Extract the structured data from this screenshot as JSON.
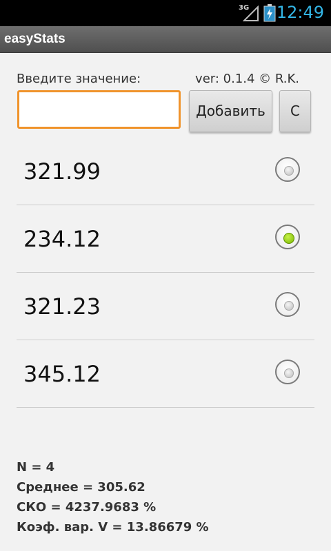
{
  "status_bar": {
    "network": "3G",
    "time": "12:49",
    "signal_icon": "signal-icon",
    "battery_icon": "battery-charging-icon",
    "time_color": "#33b5e5"
  },
  "app": {
    "title": "easyStats"
  },
  "input": {
    "label": "Введите значение:",
    "version": "ver: 0.1.4 © R.K.",
    "value": "",
    "placeholder": "",
    "focus_color": "#f0932b"
  },
  "buttons": {
    "add_label": "Добавить",
    "clear_label": "C"
  },
  "values": {
    "items": [
      {
        "value": "321.99",
        "selected": false
      },
      {
        "value": "234.12",
        "selected": true
      },
      {
        "value": "321.23",
        "selected": false
      },
      {
        "value": "345.12",
        "selected": false
      }
    ]
  },
  "stats": {
    "n": "N = 4",
    "mean": "Среднее = 305.62",
    "sko": "СКО = 4237.9683 %",
    "cv": "Коэф. вар. V = 13.86679 %"
  }
}
